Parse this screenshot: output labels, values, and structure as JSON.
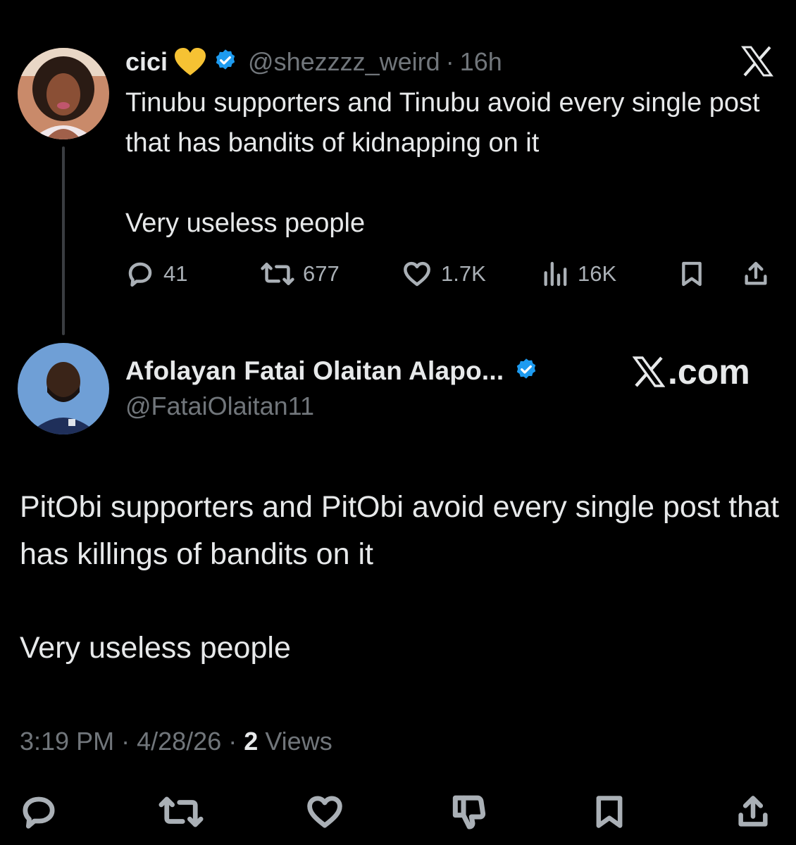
{
  "colors": {
    "background": "#000000",
    "text_primary": "#e7e9ea",
    "text_secondary": "#71767b",
    "verified_blue": "#1d9bf0",
    "heart_emoji": "#f6c233",
    "thread_line": "#3a3d41"
  },
  "quoted_tweet": {
    "name": "cici",
    "emoji_icon": "yellow-heart",
    "verified_icon": "verified-badge",
    "handle": "@shezzzz_weird",
    "separator": "·",
    "time": "16h",
    "text_line1": "Tinubu supporters and Tinubu avoid every single post that has bandits of kidnapping on it",
    "text_line2": "Very useless people",
    "actions": {
      "replies": "41",
      "reposts": "677",
      "likes": "1.7K",
      "views": "16K"
    }
  },
  "main_tweet": {
    "name": "Afolayan Fatai Olaitan Alapo...",
    "verified_icon": "verified-badge",
    "handle": "@FataiOlaitan11",
    "brand_label": ".com",
    "text_line1": "PitObi supporters and PitObi avoid every single post that has killings of bandits on it",
    "text_line2": "Very useless people",
    "time": "3:19 PM",
    "separator": "·",
    "date": "4/28/26",
    "views_count": "2",
    "views_label": "Views"
  },
  "bottom_actions": [
    "reply-icon",
    "repost-icon",
    "like-icon",
    "dislike-icon",
    "bookmark-icon",
    "share-icon"
  ]
}
